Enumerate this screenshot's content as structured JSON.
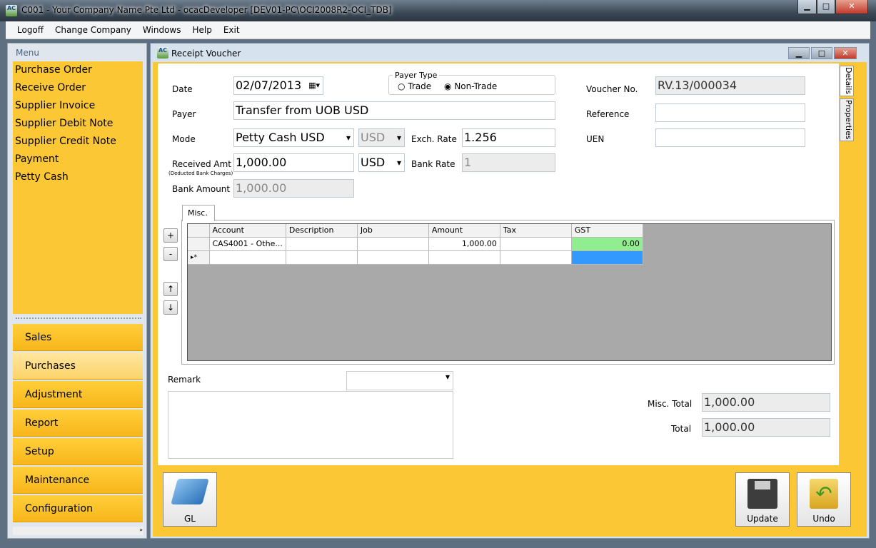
{
  "window": {
    "title": "C001 - Your Company Name Pte Ltd - ocacDeveloper [DEV01-PC\\OCI2008R2-OCI_TDB]",
    "logo": "AC"
  },
  "menubar": [
    "Logoff",
    "Change Company",
    "Windows",
    "Help",
    "Exit"
  ],
  "sidebar": {
    "header": "Menu",
    "items": [
      "Purchase Order",
      "Receive Order",
      "Supplier Invoice",
      "Supplier Debit Note",
      "Supplier Credit Note",
      "Payment",
      "Petty Cash"
    ],
    "sections": [
      "Sales",
      "Purchases",
      "Adjustment",
      "Report",
      "Setup",
      "Maintenance",
      "Configuration"
    ],
    "active_section": "Purchases"
  },
  "form": {
    "title": "Receipt Voucher",
    "date_label": "Date",
    "date": "02/07/2013",
    "payer_type_label": "Payer Type",
    "payer_types": [
      "Trade",
      "Non-Trade"
    ],
    "payer_type_selected": "Non-Trade",
    "voucher_label": "Voucher No.",
    "voucher": "RV.13/000034",
    "payer_label": "Payer",
    "payer": "Transfer from UOB USD",
    "reference_label": "Reference",
    "reference": "",
    "mode_label": "Mode",
    "mode": "Petty Cash USD",
    "mode_currency": "USD",
    "exch_label": "Exch. Rate",
    "exch": "1.256",
    "uen_label": "UEN",
    "uen": "",
    "received_label": "Received Amt",
    "received_sub": "(Deducted Bank Charges)",
    "received": "1,000.00",
    "received_currency": "USD",
    "bank_rate_label": "Bank Rate",
    "bank_rate": "1",
    "bank_amount_label": "Bank Amount",
    "bank_amount": "1,000.00",
    "tab": "Misc.",
    "side_tabs": [
      "Details",
      "Properties"
    ],
    "grid": {
      "columns": [
        "Account",
        "Description",
        "Job",
        "Amount",
        "Tax",
        "GST"
      ],
      "rows": [
        {
          "account": "CAS4001 - Othe...",
          "description": "",
          "job": "",
          "amount": "1,000.00",
          "tax": "",
          "gst": "0.00"
        }
      ],
      "new_row_marker": "▸*"
    },
    "grid_buttons": [
      "+",
      "-",
      "↑",
      "↓"
    ],
    "remark_label": "Remark",
    "remark": "",
    "misc_total_label": "Misc. Total",
    "misc_total": "1,000.00",
    "total_label": "Total",
    "total": "1,000.00"
  },
  "toolbar": {
    "gl": "GL",
    "update": "Update",
    "undo": "Undo"
  }
}
